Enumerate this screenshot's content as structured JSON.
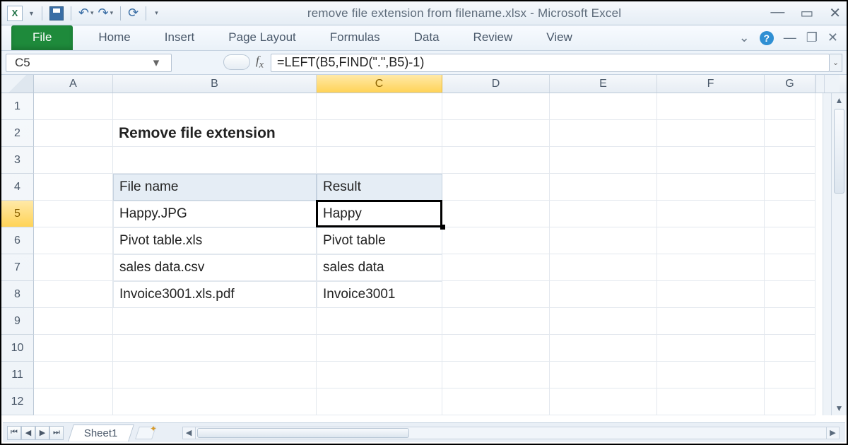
{
  "titlebar": {
    "title": "remove file extension from filename.xlsx  -  Microsoft Excel"
  },
  "ribbon": {
    "tabs": [
      "File",
      "Home",
      "Insert",
      "Page Layout",
      "Formulas",
      "Data",
      "Review",
      "View"
    ]
  },
  "namebox": {
    "value": "C5"
  },
  "formula": {
    "value": "=LEFT(B5,FIND(\".\",B5)-1)"
  },
  "columns": [
    "A",
    "B",
    "C",
    "D",
    "E",
    "F",
    "G"
  ],
  "rows": [
    "1",
    "2",
    "3",
    "4",
    "5",
    "6",
    "7",
    "8",
    "9",
    "10",
    "11",
    "12"
  ],
  "sheet": {
    "heading": "Remove file extension",
    "header_filename": "File name",
    "header_result": "Result",
    "data": [
      {
        "filename": "Happy.JPG",
        "result": "Happy"
      },
      {
        "filename": "Pivot table.xls",
        "result": "Pivot table"
      },
      {
        "filename": "sales data.csv",
        "result": "sales data"
      },
      {
        "filename": "Invoice3001.xls.pdf",
        "result": "Invoice3001"
      }
    ]
  },
  "sheet_tab": {
    "name": "Sheet1"
  },
  "active_cell": {
    "col": "C",
    "row": 5
  }
}
